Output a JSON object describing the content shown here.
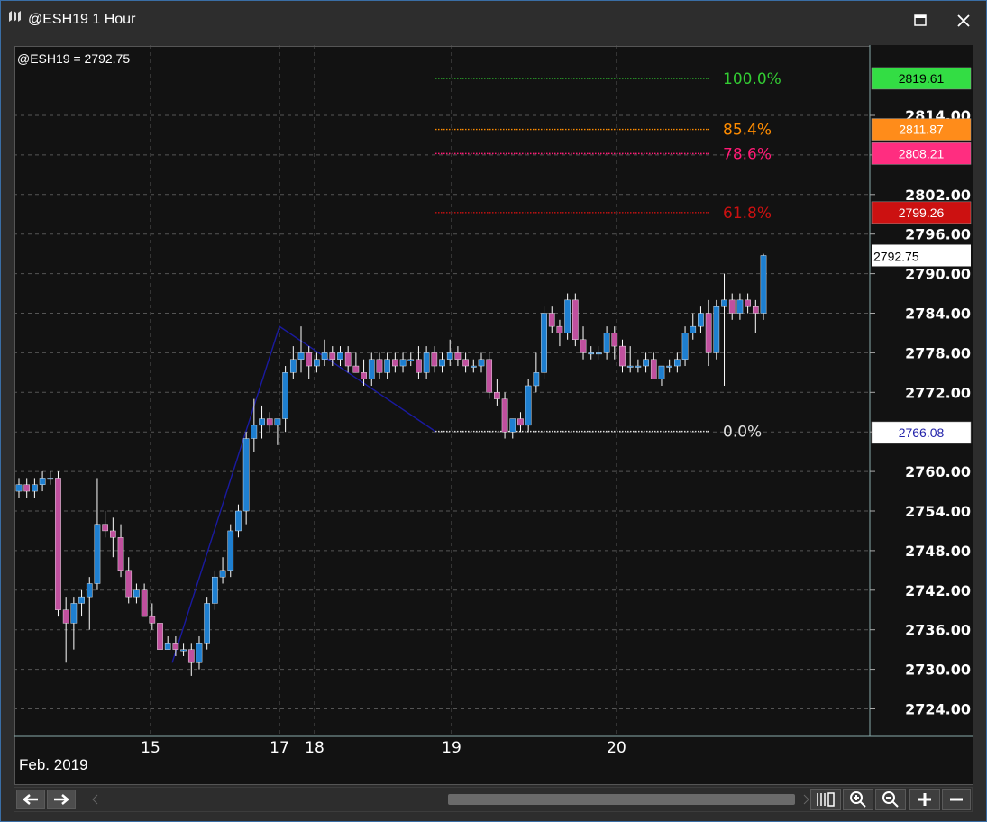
{
  "window": {
    "title": "@ESH19 1 Hour"
  },
  "chart": {
    "info_label": "@ESH19 = 2792.75",
    "date_label": "Feb. 2019",
    "x_ticks": [
      {
        "label": "15"
      },
      {
        "label": "17"
      },
      {
        "label": "18"
      },
      {
        "label": "19"
      },
      {
        "label": "20"
      }
    ],
    "y_ticks": [
      {
        "label": "2814.00",
        "value": 2814
      },
      {
        "label": "2808.00",
        "value": 2808
      },
      {
        "label": "2802.00",
        "value": 2802
      },
      {
        "label": "2796.00",
        "value": 2796
      },
      {
        "label": "2790.00",
        "value": 2790
      },
      {
        "label": "2784.00",
        "value": 2784
      },
      {
        "label": "2778.00",
        "value": 2778
      },
      {
        "label": "2772.00",
        "value": 2772
      },
      {
        "label": "2766.00",
        "value": 2766
      },
      {
        "label": "2760.00",
        "value": 2760
      },
      {
        "label": "2754.00",
        "value": 2754
      },
      {
        "label": "2748.00",
        "value": 2748
      },
      {
        "label": "2742.00",
        "value": 2742
      },
      {
        "label": "2736.00",
        "value": 2736
      },
      {
        "label": "2730.00",
        "value": 2730
      },
      {
        "label": "2724.00",
        "value": 2724
      }
    ],
    "fib_levels": [
      {
        "pct": "100.0%",
        "price": 2819.61,
        "price_label": "2819.61",
        "color": "#33cc33",
        "badge_bg": "#33dd44",
        "badge_fg": "#000000"
      },
      {
        "pct": "85.4%",
        "price": 2811.87,
        "price_label": "2811.87",
        "color": "#ff8c00",
        "badge_bg": "#ff8c1a",
        "badge_fg": "#ffffff"
      },
      {
        "pct": "78.6%",
        "price": 2808.21,
        "price_label": "2808.21",
        "color": "#ff1a75",
        "badge_bg": "#ff2d80",
        "badge_fg": "#ffffff"
      },
      {
        "pct": "61.8%",
        "price": 2799.26,
        "price_label": "2799.26",
        "color": "#cc1111",
        "badge_bg": "#cc1111",
        "badge_fg": "#ffffff"
      },
      {
        "pct": "0.0%",
        "price": 2766.08,
        "price_label": "2766.08",
        "color": "#e0e0e0",
        "badge_bg": "#ffffff",
        "badge_fg": "#2222aa"
      }
    ],
    "last_price": {
      "value": 2792.75,
      "label": "2792.75"
    },
    "colors": {
      "up_candle": "#1e7fd0",
      "down_candle": "#c0509e",
      "wick": "#ffffff",
      "fib_anchor_line": "#1a1aa0",
      "grid": "#555555"
    }
  },
  "chart_data": {
    "type": "candlestick",
    "title": "@ESH19 1 Hour",
    "xlabel": "Feb. 2019",
    "ylabel": "",
    "ylim": [
      2720,
      2822
    ],
    "bars": [
      {
        "o": 2757,
        "h": 2759,
        "l": 2756,
        "c": 2758
      },
      {
        "o": 2758,
        "h": 2759,
        "l": 2756,
        "c": 2757
      },
      {
        "o": 2757,
        "h": 2759,
        "l": 2756,
        "c": 2758
      },
      {
        "o": 2758,
        "h": 2760,
        "l": 2757,
        "c": 2759
      },
      {
        "o": 2759,
        "h": 2760,
        "l": 2758,
        "c": 2759
      },
      {
        "o": 2759,
        "h": 2760,
        "l": 2738,
        "c": 2739
      },
      {
        "o": 2739,
        "h": 2741,
        "l": 2731,
        "c": 2737
      },
      {
        "o": 2737,
        "h": 2741,
        "l": 2733,
        "c": 2740
      },
      {
        "o": 2740,
        "h": 2742,
        "l": 2738,
        "c": 2741
      },
      {
        "o": 2741,
        "h": 2744,
        "l": 2736,
        "c": 2743
      },
      {
        "o": 2743,
        "h": 2759,
        "l": 2742,
        "c": 2752
      },
      {
        "o": 2752,
        "h": 2754,
        "l": 2750,
        "c": 2751
      },
      {
        "o": 2751,
        "h": 2753,
        "l": 2747,
        "c": 2750
      },
      {
        "o": 2750,
        "h": 2752,
        "l": 2744,
        "c": 2745
      },
      {
        "o": 2745,
        "h": 2747,
        "l": 2740,
        "c": 2741
      },
      {
        "o": 2741,
        "h": 2743,
        "l": 2740,
        "c": 2742
      },
      {
        "o": 2742,
        "h": 2743,
        "l": 2738,
        "c": 2738
      },
      {
        "o": 2738,
        "h": 2740,
        "l": 2736,
        "c": 2737
      },
      {
        "o": 2737,
        "h": 2738,
        "l": 2733,
        "c": 2733
      },
      {
        "o": 2733,
        "h": 2735,
        "l": 2733,
        "c": 2734
      },
      {
        "o": 2734,
        "h": 2735,
        "l": 2732,
        "c": 2733
      },
      {
        "o": 2733,
        "h": 2734,
        "l": 2732,
        "c": 2733
      },
      {
        "o": 2733,
        "h": 2734,
        "l": 2729,
        "c": 2731
      },
      {
        "o": 2731,
        "h": 2735,
        "l": 2730,
        "c": 2734
      },
      {
        "o": 2734,
        "h": 2741,
        "l": 2733,
        "c": 2740
      },
      {
        "o": 2740,
        "h": 2745,
        "l": 2739,
        "c": 2744
      },
      {
        "o": 2744,
        "h": 2747,
        "l": 2743,
        "c": 2745
      },
      {
        "o": 2745,
        "h": 2752,
        "l": 2744,
        "c": 2751
      },
      {
        "o": 2751,
        "h": 2755,
        "l": 2750,
        "c": 2754
      },
      {
        "o": 2754,
        "h": 2766,
        "l": 2752,
        "c": 2765
      },
      {
        "o": 2765,
        "h": 2771,
        "l": 2763,
        "c": 2767
      },
      {
        "o": 2767,
        "h": 2770,
        "l": 2765,
        "c": 2768
      },
      {
        "o": 2768,
        "h": 2769,
        "l": 2766,
        "c": 2767
      },
      {
        "o": 2767,
        "h": 2768,
        "l": 2764,
        "c": 2768
      },
      {
        "o": 2768,
        "h": 2776,
        "l": 2766,
        "c": 2775
      },
      {
        "o": 2775,
        "h": 2779,
        "l": 2774,
        "c": 2777
      },
      {
        "o": 2777,
        "h": 2782,
        "l": 2775,
        "c": 2778
      },
      {
        "o": 2778,
        "h": 2779,
        "l": 2774,
        "c": 2776
      },
      {
        "o": 2776,
        "h": 2778,
        "l": 2775,
        "c": 2777
      },
      {
        "o": 2777,
        "h": 2780,
        "l": 2776,
        "c": 2778
      },
      {
        "o": 2778,
        "h": 2779,
        "l": 2776,
        "c": 2777
      },
      {
        "o": 2777,
        "h": 2779,
        "l": 2776,
        "c": 2778
      },
      {
        "o": 2778,
        "h": 2779,
        "l": 2775,
        "c": 2776
      },
      {
        "o": 2776,
        "h": 2778,
        "l": 2775,
        "c": 2775
      },
      {
        "o": 2775,
        "h": 2777,
        "l": 2773,
        "c": 2774
      },
      {
        "o": 2774,
        "h": 2778,
        "l": 2773,
        "c": 2777
      },
      {
        "o": 2777,
        "h": 2778,
        "l": 2774,
        "c": 2775
      },
      {
        "o": 2775,
        "h": 2778,
        "l": 2774,
        "c": 2777
      },
      {
        "o": 2777,
        "h": 2778,
        "l": 2775,
        "c": 2776
      },
      {
        "o": 2776,
        "h": 2778,
        "l": 2775,
        "c": 2777
      },
      {
        "o": 2777,
        "h": 2778,
        "l": 2776,
        "c": 2777
      },
      {
        "o": 2777,
        "h": 2779,
        "l": 2774,
        "c": 2775
      },
      {
        "o": 2775,
        "h": 2779,
        "l": 2774,
        "c": 2778
      },
      {
        "o": 2778,
        "h": 2779,
        "l": 2775,
        "c": 2776
      },
      {
        "o": 2776,
        "h": 2778,
        "l": 2775,
        "c": 2777
      },
      {
        "o": 2777,
        "h": 2780,
        "l": 2776,
        "c": 2778
      },
      {
        "o": 2778,
        "h": 2779,
        "l": 2776,
        "c": 2777
      },
      {
        "o": 2777,
        "h": 2778,
        "l": 2775,
        "c": 2776
      },
      {
        "o": 2776,
        "h": 2777,
        "l": 2775,
        "c": 2776
      },
      {
        "o": 2776,
        "h": 2778,
        "l": 2775,
        "c": 2777
      },
      {
        "o": 2777,
        "h": 2778,
        "l": 2771,
        "c": 2772
      },
      {
        "o": 2772,
        "h": 2774,
        "l": 2770,
        "c": 2771
      },
      {
        "o": 2771,
        "h": 2772,
        "l": 2765,
        "c": 2766
      },
      {
        "o": 2766,
        "h": 2768,
        "l": 2765,
        "c": 2768
      },
      {
        "o": 2768,
        "h": 2769,
        "l": 2766,
        "c": 2767
      },
      {
        "o": 2767,
        "h": 2774,
        "l": 2766,
        "c": 2773
      },
      {
        "o": 2773,
        "h": 2778,
        "l": 2772,
        "c": 2775
      },
      {
        "o": 2775,
        "h": 2785,
        "l": 2774,
        "c": 2784
      },
      {
        "o": 2784,
        "h": 2785,
        "l": 2781,
        "c": 2782
      },
      {
        "o": 2782,
        "h": 2783,
        "l": 2779,
        "c": 2781
      },
      {
        "o": 2781,
        "h": 2787,
        "l": 2780,
        "c": 2786
      },
      {
        "o": 2786,
        "h": 2787,
        "l": 2779,
        "c": 2780
      },
      {
        "o": 2780,
        "h": 2782,
        "l": 2777,
        "c": 2778
      },
      {
        "o": 2778,
        "h": 2779,
        "l": 2777,
        "c": 2778
      },
      {
        "o": 2778,
        "h": 2779,
        "l": 2777,
        "c": 2778
      },
      {
        "o": 2778,
        "h": 2782,
        "l": 2777,
        "c": 2781
      },
      {
        "o": 2781,
        "h": 2782,
        "l": 2777,
        "c": 2779
      },
      {
        "o": 2779,
        "h": 2780,
        "l": 2775,
        "c": 2776
      },
      {
        "o": 2776,
        "h": 2779,
        "l": 2775,
        "c": 2776
      },
      {
        "o": 2776,
        "h": 2777,
        "l": 2775,
        "c": 2776
      },
      {
        "o": 2776,
        "h": 2778,
        "l": 2775,
        "c": 2777
      },
      {
        "o": 2777,
        "h": 2778,
        "l": 2775,
        "c": 2774
      },
      {
        "o": 2774,
        "h": 2776,
        "l": 2773,
        "c": 2776
      },
      {
        "o": 2776,
        "h": 2777,
        "l": 2775,
        "c": 2776
      },
      {
        "o": 2776,
        "h": 2778,
        "l": 2775,
        "c": 2777
      },
      {
        "o": 2777,
        "h": 2782,
        "l": 2776,
        "c": 2781
      },
      {
        "o": 2781,
        "h": 2784,
        "l": 2780,
        "c": 2782
      },
      {
        "o": 2782,
        "h": 2785,
        "l": 2781,
        "c": 2784
      },
      {
        "o": 2784,
        "h": 2786,
        "l": 2776,
        "c": 2778
      },
      {
        "o": 2778,
        "h": 2786,
        "l": 2777,
        "c": 2785
      },
      {
        "o": 2785,
        "h": 2790,
        "l": 2773,
        "c": 2786
      },
      {
        "o": 2786,
        "h": 2787,
        "l": 2783,
        "c": 2784
      },
      {
        "o": 2784,
        "h": 2787,
        "l": 2783,
        "c": 2786
      },
      {
        "o": 2786,
        "h": 2787,
        "l": 2784,
        "c": 2785
      },
      {
        "o": 2785,
        "h": 2786,
        "l": 2781,
        "c": 2784
      },
      {
        "o": 2784,
        "h": 2793,
        "l": 2783,
        "c": 2792.75
      }
    ]
  },
  "toolbar": {
    "back_label": "back",
    "forward_label": "forward"
  }
}
